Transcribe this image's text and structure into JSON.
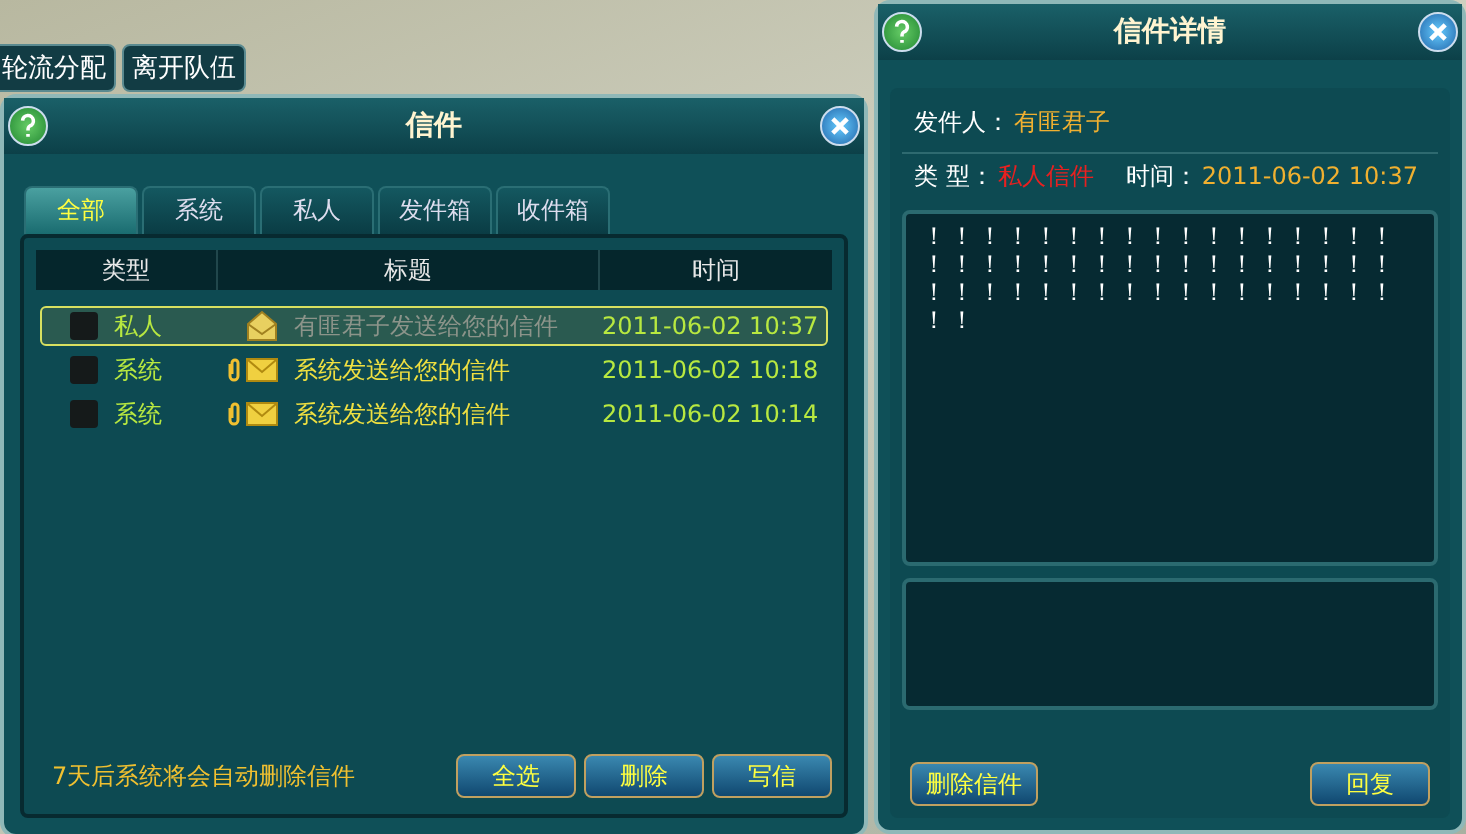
{
  "scene": {
    "party_buttons": [
      "轮流分配",
      "离开队伍"
    ]
  },
  "mail_window": {
    "title": "信件",
    "tabs": [
      {
        "label": "全部",
        "selected": true
      },
      {
        "label": "系统",
        "selected": false
      },
      {
        "label": "私人",
        "selected": false
      },
      {
        "label": "发件箱",
        "selected": false
      },
      {
        "label": "收件箱",
        "selected": false
      }
    ],
    "columns": [
      "类型",
      "标题",
      "时间"
    ],
    "rows": [
      {
        "type": "私人",
        "title": "有匪君子发送给您的信件",
        "time": "2011-06-02 10:37",
        "selected": true,
        "read": true,
        "attachment": false,
        "checked": false
      },
      {
        "type": "系统",
        "title": "系统发送给您的信件",
        "time": "2011-06-02 10:18",
        "selected": false,
        "read": false,
        "attachment": true,
        "checked": false
      },
      {
        "type": "系统",
        "title": "系统发送给您的信件",
        "time": "2011-06-02 10:14",
        "selected": false,
        "read": false,
        "attachment": true,
        "checked": false
      }
    ],
    "notice": "7天后系统将会自动删除信件",
    "buttons": [
      "全选",
      "删除",
      "写信"
    ]
  },
  "detail_window": {
    "title": "信件详情",
    "sender_label": "发件人：",
    "sender": "有匪君子",
    "type_label": "类 型：",
    "type": "私人信件",
    "time_label": "时间：",
    "time": "2011-06-02 10:37",
    "body": "！！！！！！！！！！！！！！！！！！！！！！！！！！！！！！！！！！！！！！！！！！！！！！！！！！！！！",
    "buttons": [
      "删除信件",
      "回复"
    ]
  }
}
